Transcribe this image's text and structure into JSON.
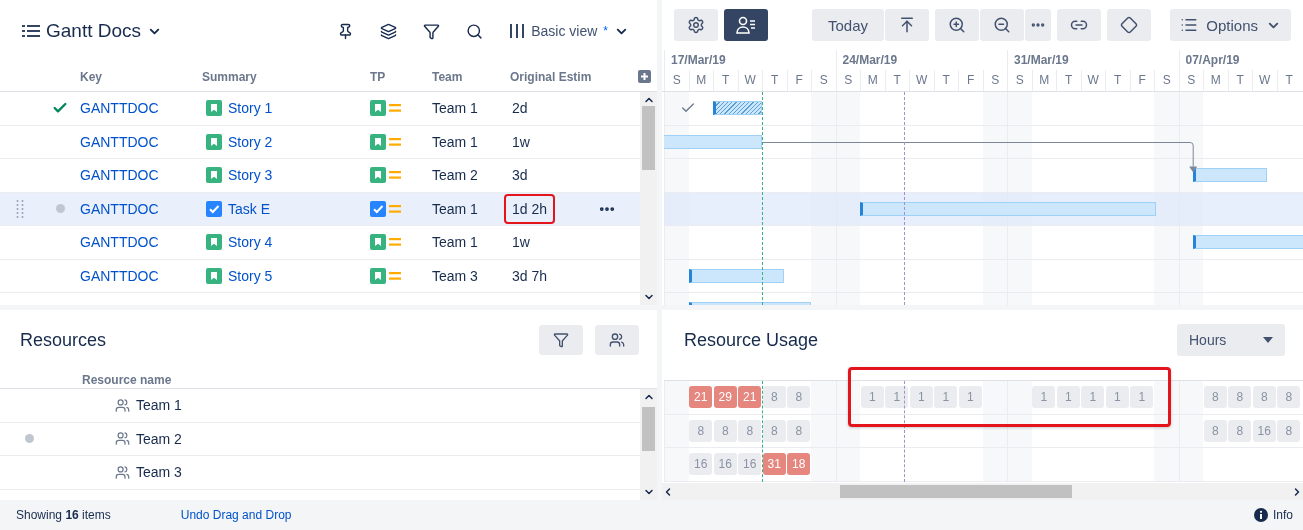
{
  "header": {
    "title": "Gantt Docs",
    "view": "Basic view",
    "view_modified_mark": "*"
  },
  "table": {
    "columns": [
      "Key",
      "Summary",
      "TP",
      "Team",
      "Original Estim"
    ],
    "rows": [
      {
        "key": "GANTTDOC",
        "summary": "Story 1",
        "kind": "story",
        "team": "Team 1",
        "estimate": "2d",
        "done": true,
        "selected": false,
        "highlighted": false
      },
      {
        "key": "GANTTDOC",
        "summary": "Story 2",
        "kind": "story",
        "team": "Team 1",
        "estimate": "1w",
        "done": false,
        "selected": false,
        "highlighted": false
      },
      {
        "key": "GANTTDOC",
        "summary": "Story 3",
        "kind": "story",
        "team": "Team 2",
        "estimate": "3d",
        "done": false,
        "selected": false,
        "highlighted": false
      },
      {
        "key": "GANTTDOC",
        "summary": "Task E",
        "kind": "task",
        "team": "Team 1",
        "estimate": "1d 2h",
        "done": false,
        "selected": true,
        "highlighted": true
      },
      {
        "key": "GANTTDOC",
        "summary": "Story 4",
        "kind": "story",
        "team": "Team 1",
        "estimate": "1w",
        "done": false,
        "selected": false,
        "highlighted": false
      },
      {
        "key": "GANTTDOC",
        "summary": "Story 5",
        "kind": "story",
        "team": "Team 3",
        "estimate": "3d 7h",
        "done": false,
        "selected": false,
        "highlighted": false
      }
    ]
  },
  "toolbar": {
    "resource_view_on": true,
    "today": "Today",
    "options": "Options"
  },
  "timeline": {
    "weeks": [
      {
        "label": "17/Mar/19",
        "days": [
          "S",
          "M",
          "T",
          "W",
          "T",
          "F",
          "S"
        ]
      },
      {
        "label": "24/Mar/19",
        "days": [
          "S",
          "M",
          "T",
          "W",
          "T",
          "F",
          "S"
        ]
      },
      {
        "label": "31/Mar/19",
        "days": [
          "S",
          "M",
          "T",
          "W",
          "T",
          "F",
          "S"
        ]
      },
      {
        "label": "07/Apr/19",
        "days": [
          "S",
          "M",
          "T",
          "W",
          "T"
        ]
      }
    ]
  },
  "resources": {
    "title": "Resources",
    "column": "Resource name",
    "rows": [
      {
        "name": "Team 1",
        "selected": false
      },
      {
        "name": "Team 2",
        "selected": true
      },
      {
        "name": "Team 3",
        "selected": false
      }
    ]
  },
  "usage": {
    "title": "Resource Usage",
    "unit": "Hours",
    "highlighted": true,
    "rows": [
      {
        "cells": [
          null,
          {
            "value": "21",
            "over": true
          },
          {
            "value": "29",
            "over": true
          },
          {
            "value": "21",
            "over": true
          },
          {
            "value": "8",
            "over": false
          },
          {
            "value": "8",
            "over": false
          },
          null,
          null,
          {
            "value": "1",
            "over": false
          },
          {
            "value": "1",
            "over": false
          },
          {
            "value": "1",
            "over": false
          },
          {
            "value": "1",
            "over": false
          },
          {
            "value": "1",
            "over": false
          },
          null,
          null,
          {
            "value": "1",
            "over": false
          },
          {
            "value": "1",
            "over": false
          },
          {
            "value": "1",
            "over": false
          },
          {
            "value": "1",
            "over": false
          },
          {
            "value": "1",
            "over": false
          },
          null,
          null,
          {
            "value": "8",
            "over": false
          },
          {
            "value": "8",
            "over": false
          },
          {
            "value": "8",
            "over": false
          },
          {
            "value": "8",
            "over": false
          }
        ]
      },
      {
        "cells": [
          null,
          {
            "value": "8",
            "over": false
          },
          {
            "value": "8",
            "over": false
          },
          {
            "value": "8",
            "over": false
          },
          {
            "value": "8",
            "over": false
          },
          {
            "value": "8",
            "over": false
          },
          null,
          null,
          null,
          null,
          null,
          null,
          null,
          null,
          null,
          null,
          null,
          null,
          null,
          null,
          null,
          null,
          {
            "value": "8",
            "over": false
          },
          {
            "value": "8",
            "over": false
          },
          {
            "value": "16",
            "over": false
          },
          {
            "value": "8",
            "over": false
          }
        ]
      },
      {
        "cells": [
          null,
          {
            "value": "16",
            "over": false
          },
          {
            "value": "16",
            "over": false
          },
          {
            "value": "16",
            "over": false
          },
          {
            "value": "31",
            "over": true
          },
          {
            "value": "18",
            "over": true
          },
          null,
          null,
          null,
          null,
          null,
          null,
          null,
          null,
          null,
          null,
          null,
          null,
          null,
          null,
          null,
          null,
          null,
          null,
          null,
          null
        ]
      }
    ]
  },
  "status": {
    "showing": "Showing **16** items",
    "undo": "Undo Drag and Drop",
    "info": "Info"
  }
}
